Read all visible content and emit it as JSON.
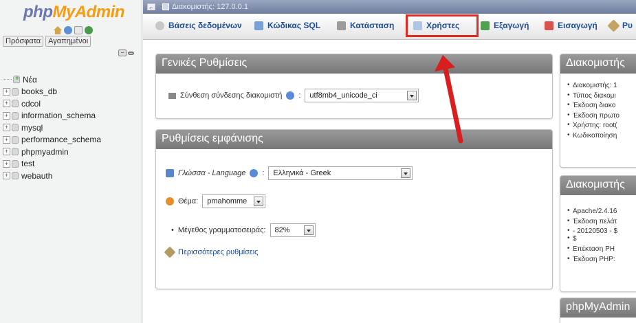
{
  "nav": {
    "logo_php": "php",
    "logo_myadmin": "MyAdmin",
    "tabs": [
      "Πρόσφατα",
      "Αγαπημένοι"
    ],
    "tree": [
      {
        "label": "Νέα",
        "new": true
      },
      {
        "label": "books_db"
      },
      {
        "label": "cdcol"
      },
      {
        "label": "information_schema"
      },
      {
        "label": "mysql"
      },
      {
        "label": "performance_schema"
      },
      {
        "label": "phpmyadmin"
      },
      {
        "label": "test"
      },
      {
        "label": "webauth"
      }
    ]
  },
  "topbar": {
    "breadcrumb": "Διακομιστής: 127.0.0.1"
  },
  "menu": {
    "items": [
      {
        "label": "Βάσεις δεδομένων",
        "icon": "databases-icon"
      },
      {
        "label": "Κώδικας SQL",
        "icon": "sql-icon"
      },
      {
        "label": "Κατάσταση",
        "icon": "status-icon"
      },
      {
        "label": "Χρήστες",
        "icon": "users-icon"
      },
      {
        "label": "Εξαγωγή",
        "icon": "export-icon"
      },
      {
        "label": "Εισαγωγή",
        "icon": "import-icon"
      },
      {
        "label": "Ρυ",
        "icon": "settings-icon"
      }
    ]
  },
  "general_settings": {
    "title": "Γενικές Ρυθμίσεις",
    "collation_label": "Σύνθεση σύνδεσης διακομιστή",
    "collation_value": "utf8mb4_unicode_ci"
  },
  "appearance": {
    "title": "Ρυθμίσεις εμφάνισης",
    "language_label": "Γλώσσα - Language",
    "language_value": "Ελληνικά - Greek",
    "theme_label": "Θέμα:",
    "theme_value": "pmahomme",
    "font_label": "Μέγεθος γραμματοσειράς:",
    "font_value": "82%",
    "more_settings": "Περισσότερες ρυθμίσεις"
  },
  "server_panel": {
    "title": "Διακομιστής",
    "items": [
      "Διακομιστής: 1",
      "Τύπος διακομι",
      "Έκδοση διακο",
      "Έκδοση πρωτο",
      "Χρήστης: root(",
      "Κωδικοποίηση"
    ]
  },
  "webserver_panel": {
    "title": "Διακομιστής",
    "items": [
      "Apache/2.4.16",
      "Έκδοση πελάτ",
      "- 20120503 - $",
      "$",
      "Επέκταση PH",
      "Έκδοση PHP:"
    ]
  },
  "pma_panel": {
    "title": "phpMyAdmin"
  },
  "colors": {
    "highlight": "#e02a24",
    "link": "#1b4c9a",
    "logo_blue": "#6c78af",
    "logo_orange": "#f89c0e"
  }
}
